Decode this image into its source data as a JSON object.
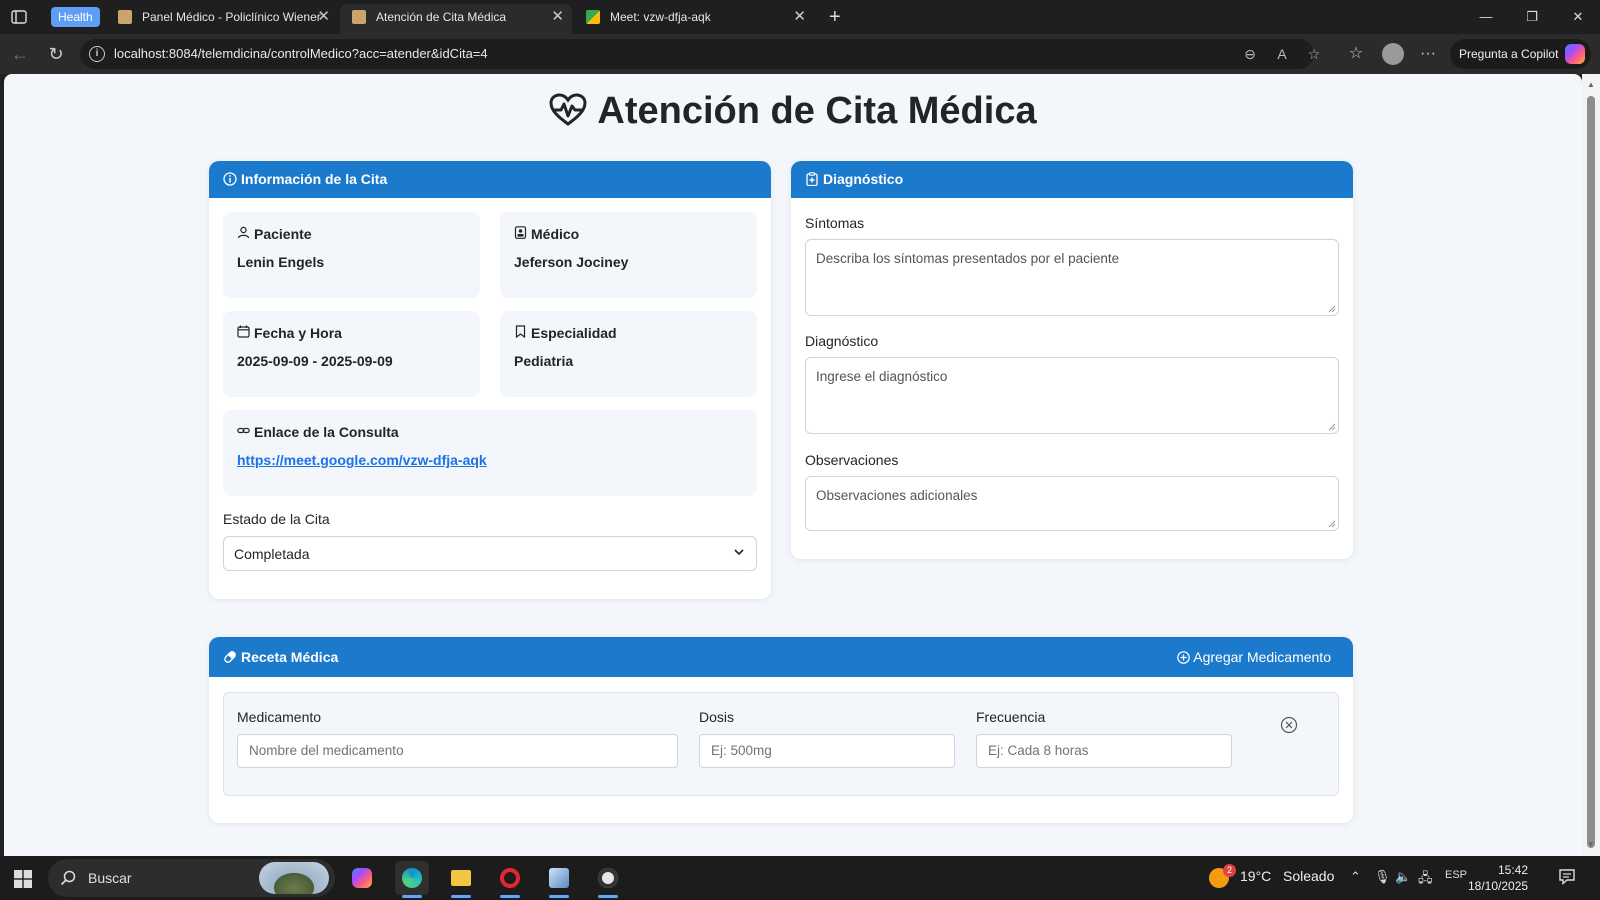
{
  "browser": {
    "tab_group_label": "Health",
    "tabs": [
      {
        "title": "Panel Médico - Policlínico Wiener",
        "active": false
      },
      {
        "title": "Atención de Cita Médica",
        "active": true
      },
      {
        "title": "Meet: vzw-dfja-aqk",
        "active": false
      }
    ],
    "url": "localhost:8084/telemdicina/controlMedico?acc=atender&idCita=4",
    "copilot_label": "Pregunta a Copilot"
  },
  "page": {
    "title": "Atención de Cita Médica",
    "info_card": {
      "header": "Información de la Cita",
      "patient_label": "Paciente",
      "patient_value": "Lenin Engels",
      "doctor_label": "Médico",
      "doctor_value": "Jeferson Jociney",
      "datetime_label": "Fecha y Hora",
      "datetime_value": "2025-09-09 - 2025-09-09",
      "specialty_label": "Especialidad",
      "specialty_value": "Pediatria",
      "link_label": "Enlace de la Consulta",
      "link_value": "https://meet.google.com/vzw-dfja-aqk",
      "status_label": "Estado de la Cita",
      "status_value": "Completada"
    },
    "diagnosis_card": {
      "header": "Diagnóstico",
      "symptoms_label": "Síntomas",
      "symptoms_placeholder": "Describa los síntomas presentados por el paciente",
      "diagnosis_label": "Diagnóstico",
      "diagnosis_placeholder": "Ingrese el diagnóstico",
      "observations_label": "Observaciones",
      "observations_placeholder": "Observaciones adicionales"
    },
    "prescription_card": {
      "header": "Receta Médica",
      "add_button": "Agregar Medicamento",
      "medication_label": "Medicamento",
      "medication_placeholder": "Nombre del medicamento",
      "dose_label": "Dosis",
      "dose_placeholder": "Ej: 500mg",
      "frequency_label": "Frecuencia",
      "frequency_placeholder": "Ej: Cada 8 horas"
    }
  },
  "taskbar": {
    "search_label": "Buscar",
    "weather_badge": "2",
    "weather_temp": "19°C",
    "weather_desc": "Soleado",
    "language": "ESP",
    "time": "15:42",
    "date": "18/10/2025"
  },
  "colors": {
    "primary": "#1c7acc",
    "page_bg": "#f3f6fa",
    "link": "#1a73e8"
  }
}
